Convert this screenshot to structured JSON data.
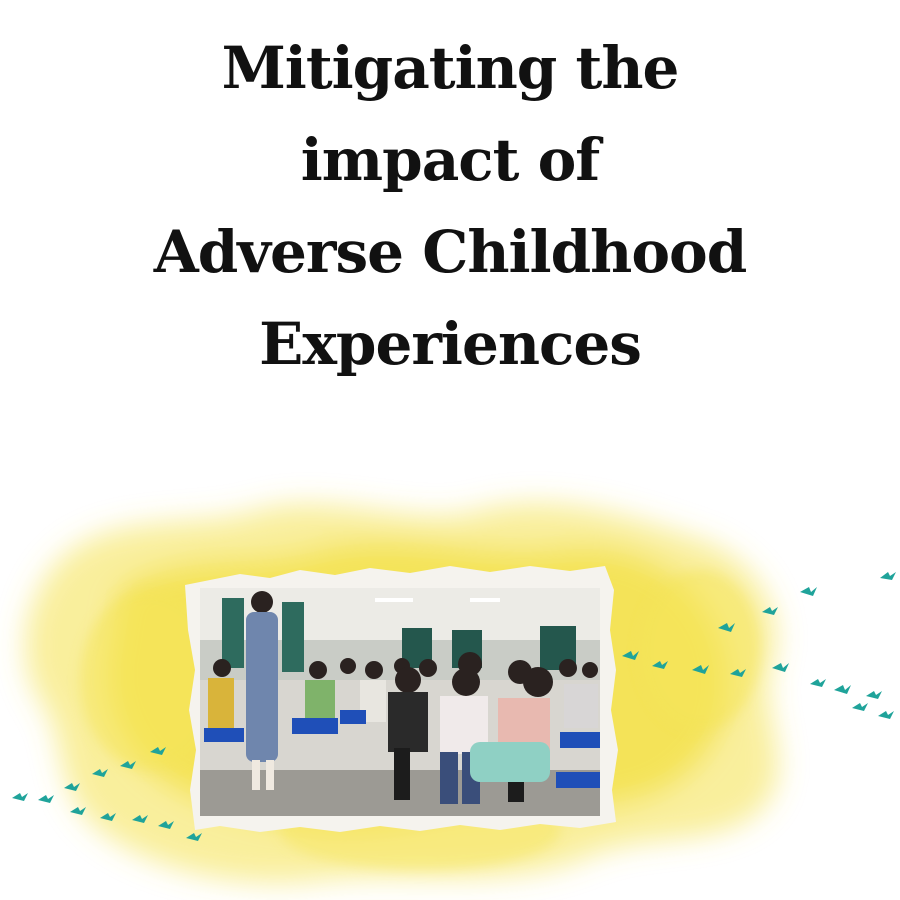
{
  "title_lines": [
    "Mitigating the",
    "impact of",
    "Adverse Childhood",
    "Experiences"
  ],
  "colors": {
    "background": "#ffffff",
    "title_text": "#111111",
    "watercolor": "#f4e24a",
    "birds": "#1fa39a"
  },
  "icons": [
    "bird-icon"
  ]
}
